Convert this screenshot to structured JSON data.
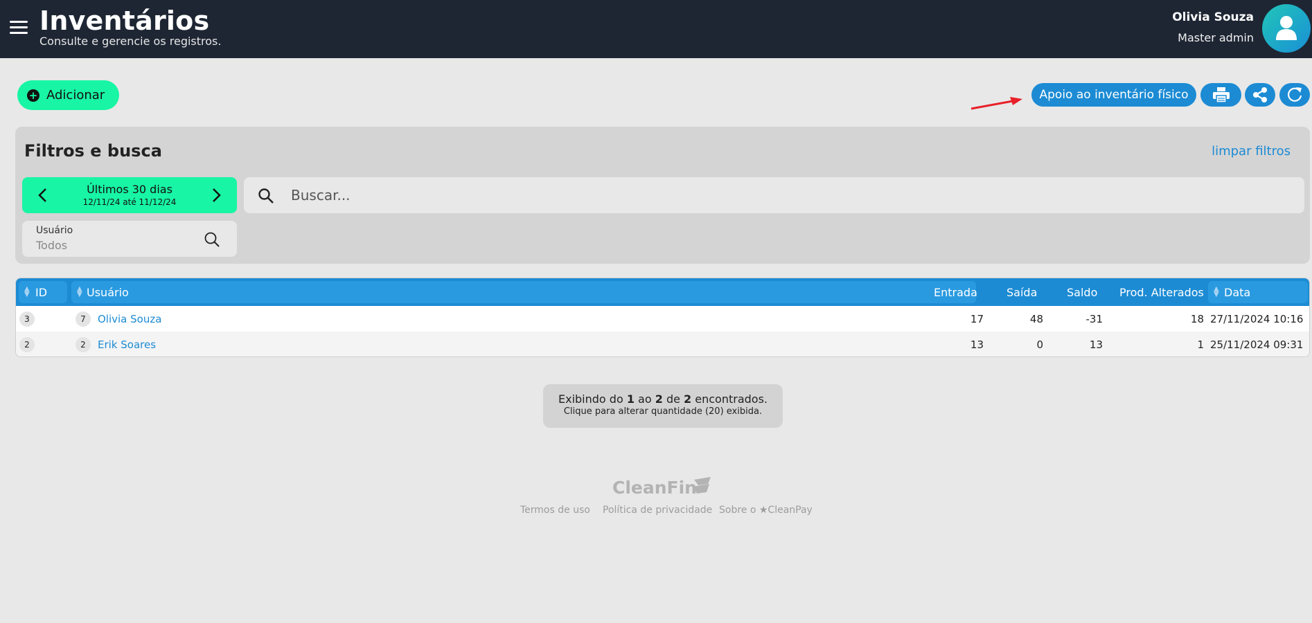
{
  "header": {
    "title": "Inventários",
    "subtitle": "Consulte e gerencie os registros.",
    "user_name": "Olivia Souza",
    "user_role": "Master admin"
  },
  "actions": {
    "add_label": "Adicionar",
    "apoio_label": "Apoio ao inventário físico"
  },
  "filters": {
    "title": "Filtros e busca",
    "clear_label": "limpar filtros",
    "period_label": "Últimos 30 dias",
    "period_range": "12/11/24 até 11/12/24",
    "search_placeholder": "Buscar...",
    "user_label": "Usuário",
    "user_value": "Todos"
  },
  "table": {
    "columns": {
      "id": "ID",
      "usuario": "Usuário",
      "entrada": "Entrada",
      "saida": "Saída",
      "saldo": "Saldo",
      "prod": "Prod. Alterados",
      "data": "Data"
    },
    "rows": [
      {
        "id": "3",
        "user_id": "7",
        "user": "Olivia Souza",
        "entrada": "17",
        "saida": "48",
        "saldo": "-31",
        "prod": "18",
        "data": "27/11/2024 10:16"
      },
      {
        "id": "2",
        "user_id": "2",
        "user": "Erik Soares",
        "entrada": "13",
        "saida": "0",
        "saldo": "13",
        "prod": "1",
        "data": "25/11/2024 09:31"
      }
    ]
  },
  "pager": {
    "pre": "Exibindo do ",
    "from": "1",
    "mid1": " ao ",
    "to": "2",
    "mid2": " de ",
    "total": "2",
    "post": " encontrados.",
    "line2": "Clique para alterar quantidade (20) exibida."
  },
  "footer": {
    "brand": "CleanFin",
    "links": [
      "Termos de uso",
      "Política de privacidade",
      "Sobre o ★CleanPay"
    ]
  },
  "colors": {
    "header_bg": "#1e2634",
    "accent_green": "#18f5a4",
    "accent_blue": "#1c8bd4",
    "arrow_red": "#e8202a"
  }
}
